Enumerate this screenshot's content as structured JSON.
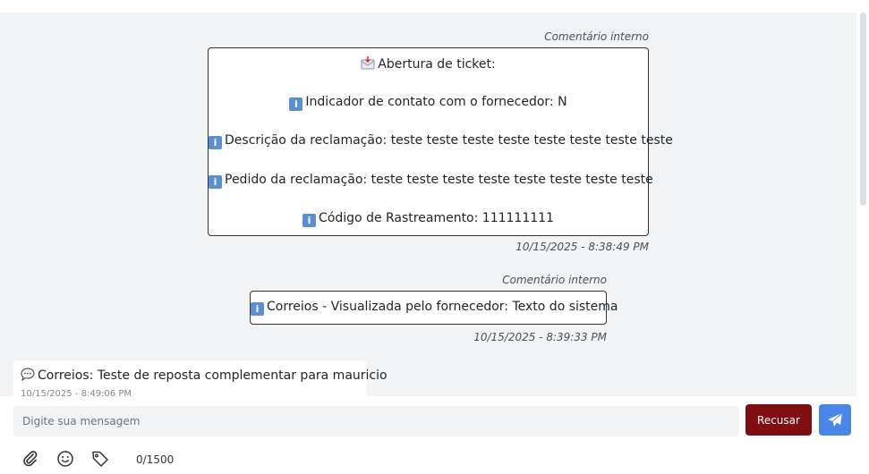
{
  "messages": [
    {
      "label": "Comentário interno",
      "lines": [
        {
          "icon": "inbox-icon",
          "text": "Abertura de ticket:"
        },
        {
          "icon": "info-icon",
          "text": "Indicador de contato com o fornecedor: N"
        },
        {
          "icon": "info-icon",
          "text": "Descrição da reclamação: teste teste teste teste teste teste teste teste"
        },
        {
          "icon": "info-icon",
          "text": "Pedido da reclamação: teste teste teste teste teste teste teste teste"
        },
        {
          "icon": "info-icon",
          "text": "Código de Rastreamento: 111111111"
        }
      ],
      "timestamp": "10/15/2025 - 8:38:49 PM"
    },
    {
      "label": "Comentário interno",
      "lines": [
        {
          "icon": "info-icon",
          "text": "Correios - Visualizada pelo fornecedor: Texto do sistema"
        }
      ],
      "timestamp": "10/15/2025 - 8:39:33 PM"
    },
    {
      "icon": "speech-balloon-icon",
      "text": "Correios: Teste de reposta complementar para mauricio",
      "timestamp": "10/15/2025 - 8:49:06 PM"
    }
  ],
  "composer": {
    "placeholder": "Digite sua mensagem",
    "value": "",
    "refuse_label": "Recusar",
    "send_icon": "paper-plane-icon",
    "tools": [
      "paperclip-icon",
      "smile-icon",
      "tag-icon"
    ],
    "counter": "0/1500"
  },
  "colors": {
    "refuse": "#7e0e12",
    "send": "#4a86e8",
    "background": "#f1f3f5"
  }
}
